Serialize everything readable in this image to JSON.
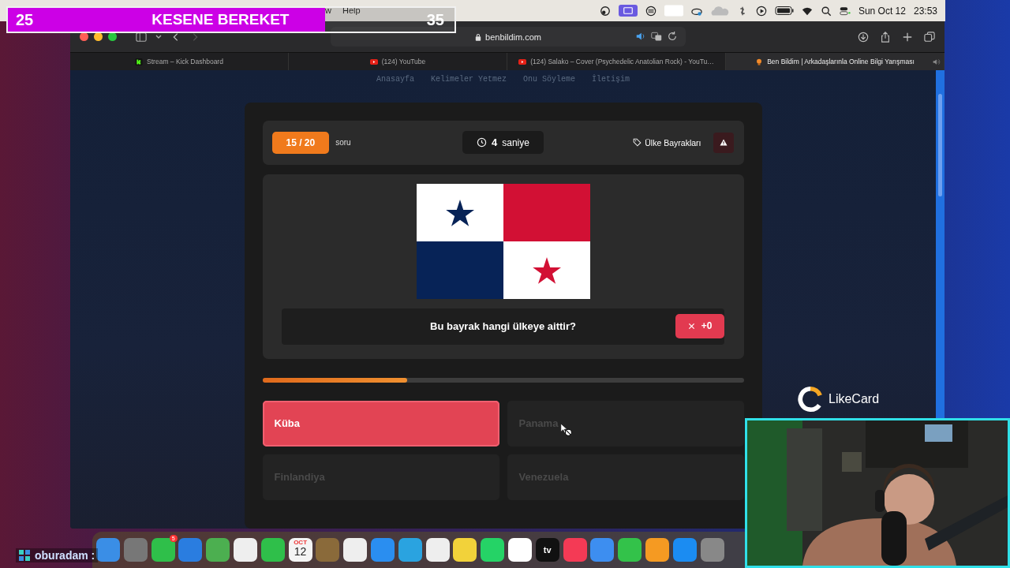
{
  "menu_bar": {
    "menus": [
      "w",
      "Help"
    ],
    "date": "Sun Oct 12",
    "time": "23:53"
  },
  "stream_overlay": {
    "left_count": "25",
    "title": "KESENE BEREKET",
    "right_count": "35",
    "level": 0.71
  },
  "browser": {
    "address": "benbildim.com",
    "tabs": [
      {
        "title": "Stream – Kick Dashboard",
        "kind": "kick",
        "selected": false
      },
      {
        "title": "(124) YouTube",
        "kind": "youtube",
        "selected": false
      },
      {
        "title": "(124) Salako – Cover (Psychedelic Anatolian Rock) - YouTu…",
        "kind": "youtube",
        "selected": false
      },
      {
        "title": "Ben Bildim | Arkadaşlarınla Online Bilgi Yarışması",
        "kind": "site",
        "selected": true
      }
    ]
  },
  "site": {
    "nav": [
      "Anasayfa",
      "Kelimeler Yetmez",
      "Onu Söyleme",
      "İletişim"
    ],
    "quiz": {
      "counter": "15 / 20",
      "counter_label": "soru",
      "timer_value": "4",
      "timer_unit": "saniye",
      "category": "Ülke Bayrakları",
      "question": "Bu bayrak hangi ülkeye aittir?",
      "score": "+0",
      "level": 0.3,
      "answers": [
        {
          "label": "Küba",
          "selected": true
        },
        {
          "label": "Panama",
          "selected": false
        },
        {
          "label": "Finlandiya",
          "selected": false
        },
        {
          "label": "Venezuela",
          "selected": false
        }
      ]
    }
  },
  "sponsor": {
    "name": "LikeCard"
  },
  "dock": {
    "messages_badge": "5",
    "calendar_month": "OCT",
    "calendar_day": "12",
    "tv_label": "tv"
  },
  "chat": {
    "text": "oburadam :"
  }
}
